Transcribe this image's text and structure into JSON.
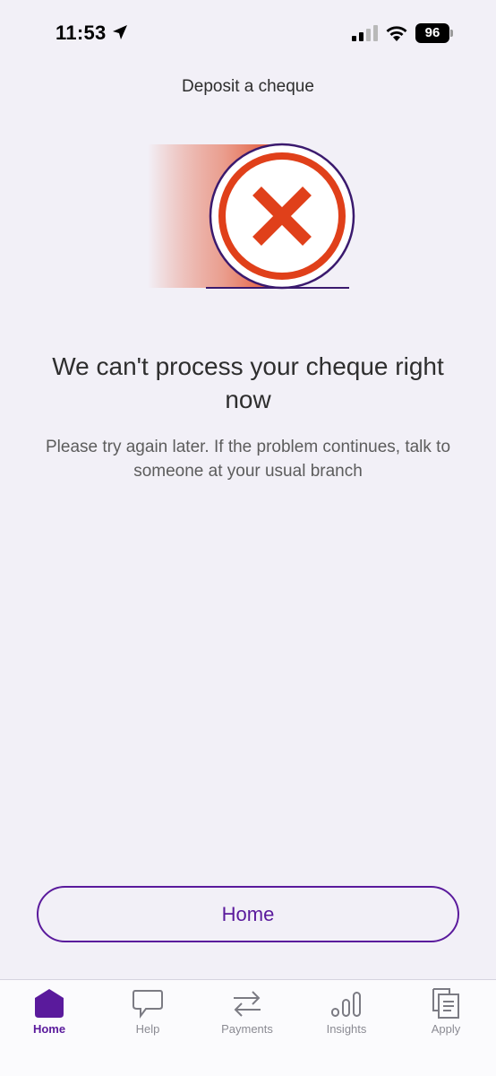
{
  "status_bar": {
    "time": "11:53",
    "battery": "96",
    "icons": [
      "location-arrow-icon",
      "signal-icon",
      "wifi-icon",
      "battery-icon"
    ]
  },
  "header": {
    "title": "Deposit a cheque"
  },
  "illustration": {
    "icon": "error-x-icon",
    "accent_color": "#e0401a",
    "outline_color": "#3b1a6e"
  },
  "content": {
    "headline": "We can't process your cheque right now",
    "message": "Please try again later. If the problem continues, talk to someone at your usual branch"
  },
  "actions": {
    "home_label": "Home"
  },
  "tab_bar": {
    "items": [
      {
        "label": "Home",
        "icon": "home-icon",
        "active": true
      },
      {
        "label": "Help",
        "icon": "speech-bubble-icon",
        "active": false
      },
      {
        "label": "Payments",
        "icon": "transfer-arrows-icon",
        "active": false
      },
      {
        "label": "Insights",
        "icon": "bar-chart-icon",
        "active": false
      },
      {
        "label": "Apply",
        "icon": "documents-icon",
        "active": false
      }
    ]
  },
  "colors": {
    "brand": "#5a1a9c",
    "background": "#f2f0f7",
    "error": "#e0401a"
  }
}
